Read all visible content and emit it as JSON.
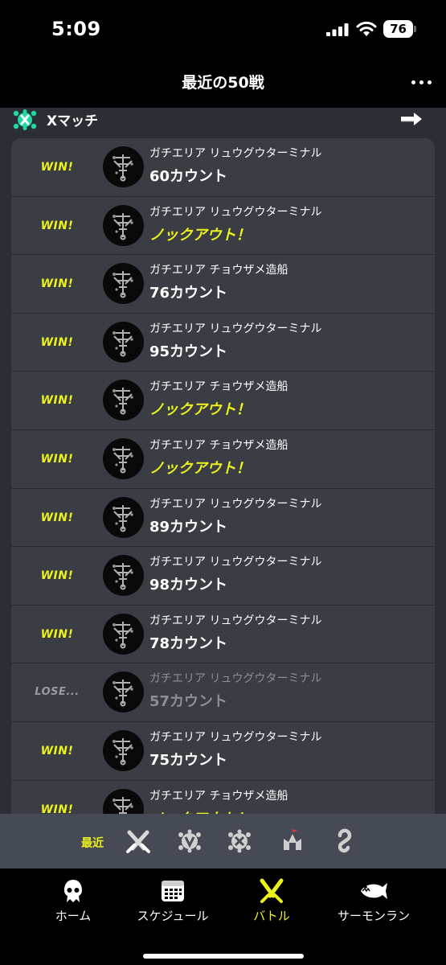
{
  "status": {
    "time": "5:09",
    "battery": "76"
  },
  "header": {
    "title": "最近の50戦"
  },
  "section": {
    "title": "Xマッチ"
  },
  "battles": [
    {
      "result": "WIN!",
      "stage": "ガチエリア リュウグウターミナル",
      "score": "60カウント",
      "knockout": false
    },
    {
      "result": "WIN!",
      "stage": "ガチエリア リュウグウターミナル",
      "score": "ノックアウト！",
      "knockout": true
    },
    {
      "result": "WIN!",
      "stage": "ガチエリア チョウザメ造船",
      "score": "76カウント",
      "knockout": false
    },
    {
      "result": "WIN!",
      "stage": "ガチエリア リュウグウターミナル",
      "score": "95カウント",
      "knockout": false
    },
    {
      "result": "WIN!",
      "stage": "ガチエリア チョウザメ造船",
      "score": "ノックアウト！",
      "knockout": true
    },
    {
      "result": "WIN!",
      "stage": "ガチエリア チョウザメ造船",
      "score": "ノックアウト！",
      "knockout": true
    },
    {
      "result": "WIN!",
      "stage": "ガチエリア リュウグウターミナル",
      "score": "89カウント",
      "knockout": false
    },
    {
      "result": "WIN!",
      "stage": "ガチエリア リュウグウターミナル",
      "score": "98カウント",
      "knockout": false
    },
    {
      "result": "WIN!",
      "stage": "ガチエリア リュウグウターミナル",
      "score": "78カウント",
      "knockout": false
    },
    {
      "result": "LOSE...",
      "stage": "ガチエリア リュウグウターミナル",
      "score": "57カウント",
      "knockout": false
    },
    {
      "result": "WIN!",
      "stage": "ガチエリア リュウグウターミナル",
      "score": "75カウント",
      "knockout": false
    },
    {
      "result": "WIN!",
      "stage": "ガチエリア チョウザメ造船",
      "score": "ノックアウト！",
      "knockout": true
    }
  ],
  "filter": {
    "label": "最近",
    "icons": [
      "regular-battle-icon",
      "bankara-battle-icon",
      "x-battle-icon",
      "event-battle-icon",
      "private-battle-icon"
    ]
  },
  "tabs": [
    {
      "label": "ホーム",
      "icon": "squid-home-icon",
      "active": false
    },
    {
      "label": "スケジュール",
      "icon": "calendar-icon",
      "active": false
    },
    {
      "label": "バトル",
      "icon": "battle-icon",
      "active": true
    },
    {
      "label": "サーモンラン",
      "icon": "salmon-icon",
      "active": false
    }
  ],
  "colors": {
    "accent": "#ecf21c",
    "win": "#ecf21c",
    "lose": "#9a9aa0",
    "list_bg": "#3a3d44",
    "content_bg": "#2b2e34",
    "filter_bg": "#454a54",
    "x_match": "#1fd9a3"
  }
}
